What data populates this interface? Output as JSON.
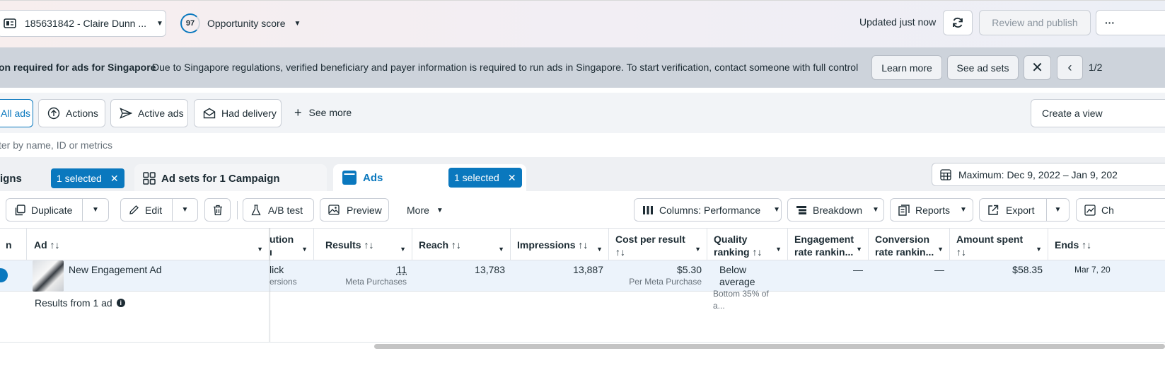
{
  "topbar": {
    "account": "185631842 - Claire Dunn ...",
    "score_value": "97",
    "score_label": "Opportunity score",
    "updated": "Updated just now",
    "review_publish": "Review and publish",
    "more": "···"
  },
  "banner": {
    "title": "on required for ads for Singapore",
    "message": "Due to Singapore regulations, verified beneficiary and payer information is required to run ads in Singapore. To start verification, contact someone with full control ...",
    "learn_more": "Learn more",
    "see_ad_sets": "See ad sets",
    "pager": "1/2"
  },
  "filters": {
    "all_ads": "All ads",
    "actions": "Actions",
    "active_ads": "Active ads",
    "had_delivery": "Had delivery",
    "see_more": "See more",
    "create_view": "Create a view"
  },
  "search": {
    "placeholder": "ter by name, ID or metrics"
  },
  "tabs": {
    "campaigns": "igns",
    "campaigns_selected": "1 selected",
    "adsets": "Ad sets for 1 Campaign",
    "ads": "Ads",
    "ads_selected": "1 selected",
    "date_range": "Maximum: Dec 9, 2022 – Jan 9, 202"
  },
  "toolbar": {
    "duplicate": "Duplicate",
    "edit": "Edit",
    "ab_test": "A/B test",
    "preview": "Preview",
    "more": "More",
    "columns": "Columns: Performance",
    "breakdown": "Breakdown",
    "reports": "Reports",
    "export": "Export",
    "charts": "Ch"
  },
  "table": {
    "headers": {
      "off_on": "n",
      "ad": "Ad ↑↓",
      "attribution_1": "ution",
      "attribution_2": "ı",
      "results": "Results ↑↓",
      "reach": "Reach ↑↓",
      "impressions": "Impressions ↑↓",
      "cost_1": "Cost per result",
      "cost_2": "↑↓",
      "quality_1": "Quality",
      "quality_2": "ranking ↑↓",
      "engagement_1": "Engagement",
      "engagement_2": "rate rankin...",
      "conversion_1": "Conversion",
      "conversion_2": "rate rankin...",
      "amount_1": "Amount spent",
      "amount_2": "↑↓",
      "ends": "Ends ↑↓"
    },
    "row": {
      "ad_name": "New Engagement Ad",
      "attribution": "lick",
      "attribution_sub": "ersions",
      "results": "11",
      "results_sub": "Meta Purchases",
      "reach": "13,783",
      "impressions": "13,887",
      "cost": "$5.30",
      "cost_sub": "Per Meta Purchase",
      "quality": "Below average",
      "quality_sub": "Bottom 35% of a...",
      "engagement": "—",
      "conversion": "—",
      "amount": "$58.35",
      "ends": "Mar 7, 20"
    },
    "summary": "Results from 1 ad"
  },
  "colors": {
    "accent": "#0a78be",
    "banner": "#cdd3db"
  }
}
